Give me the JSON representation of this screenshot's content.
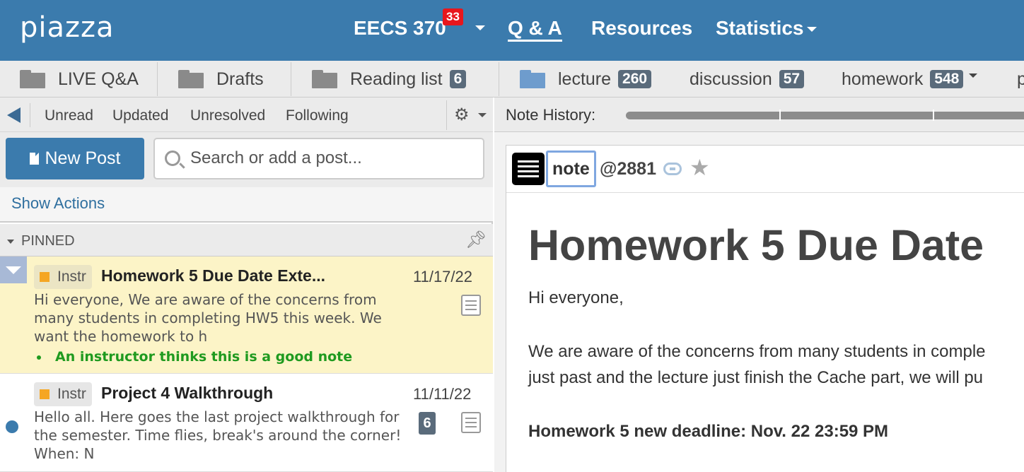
{
  "header": {
    "logo": "piazza",
    "course": "EECS 370",
    "course_badge": "33",
    "nav": {
      "qa": "Q & A",
      "resources": "Resources",
      "statistics": "Statistics"
    }
  },
  "folders": {
    "live_qa": "LIVE Q&A",
    "drafts": "Drafts",
    "reading_list": "Reading list",
    "reading_list_count": "6",
    "lecture": "lecture",
    "lecture_count": "260",
    "discussion": "discussion",
    "discussion_count": "57",
    "homework": "homework",
    "homework_count": "548",
    "overflow": "p"
  },
  "filters": {
    "unread": "Unread",
    "updated": "Updated",
    "unresolved": "Unresolved",
    "following": "Following"
  },
  "actions": {
    "new_post": "New Post",
    "search_placeholder": "Search or add a post...",
    "show_actions": "Show Actions"
  },
  "pinned_label": "PINNED",
  "posts": [
    {
      "tag": "Instr",
      "title": "Homework 5 Due Date Exte...",
      "date": "11/17/22",
      "snippet": "Hi everyone, We are aware of the concerns from many students in completing HW5 this week. We want the homework to h",
      "good_note": "An instructor thinks this is a good note"
    },
    {
      "tag": "Instr",
      "title": "Project 4 Walkthrough",
      "date": "11/11/22",
      "snippet": "Hello all. Here goes the last project walkthrough for the semester. Time flies, break's around the corner! When: N",
      "replies": "6"
    }
  ],
  "note": {
    "history_label": "Note History:",
    "type": "note",
    "number": "@2881",
    "title": "Homework 5 Due Date",
    "greeting": "Hi everyone,",
    "line1": "We are aware of the concerns from many students in comple",
    "line2": "just past and the lecture just finish the Cache part, we will pu",
    "deadline": "Homework 5 new deadline: Nov. 22  23:59 PM"
  },
  "colors": {
    "brand": "#3b7bad",
    "badge_red": "#e8161c",
    "pinned_highlight": "#fcf4c7",
    "good_note_green": "#1f9a1f"
  }
}
